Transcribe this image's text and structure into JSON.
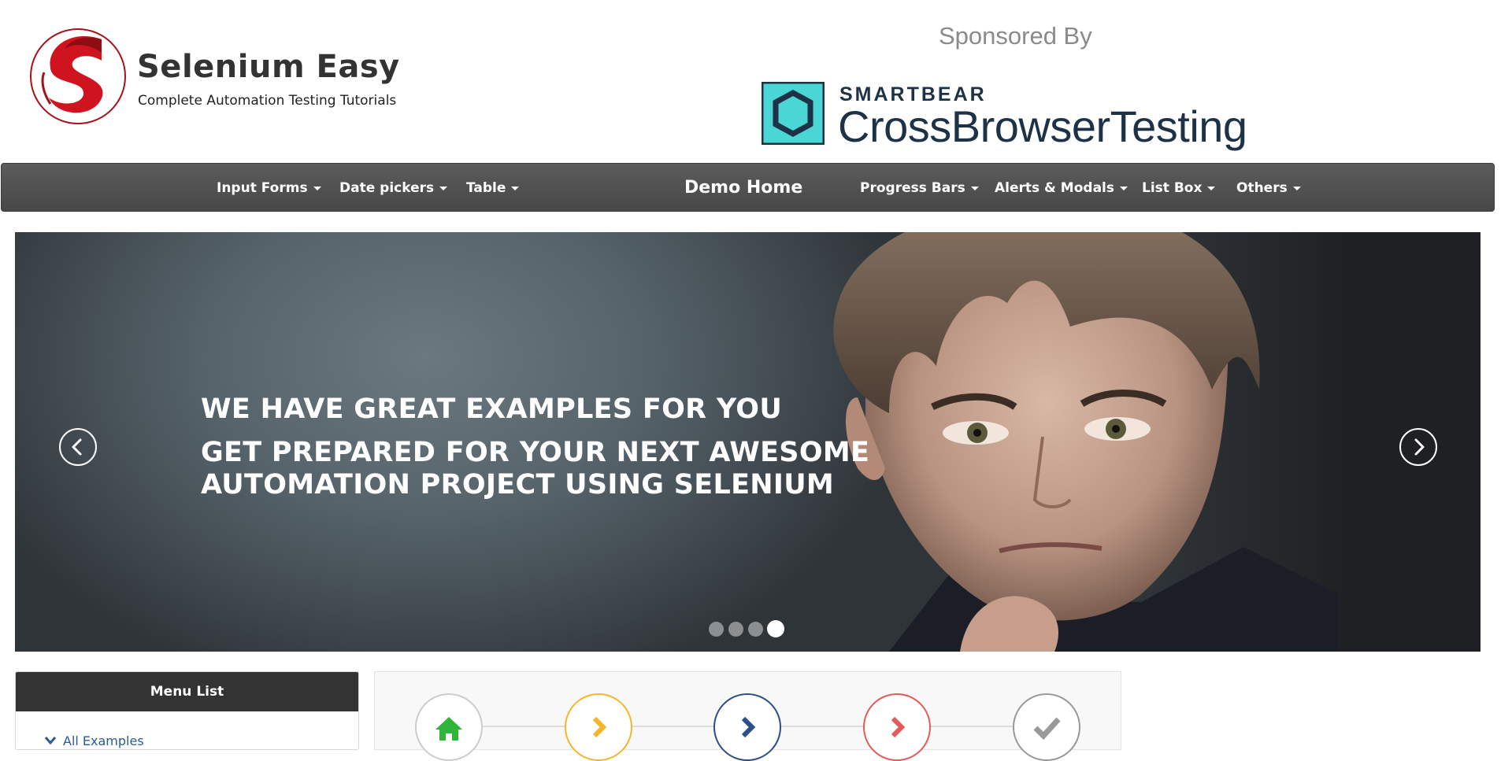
{
  "brand": {
    "title": "Selenium Easy",
    "tagline": "Complete Automation Testing Tutorials"
  },
  "sponsor": {
    "label": "Sponsored By",
    "brand": "SMARTBEAR",
    "product": "CrossBrowserTesting"
  },
  "nav": {
    "items_left": [
      "Input Forms",
      "Date pickers",
      "Table"
    ],
    "home": "Demo Home",
    "items_right": [
      "Progress Bars",
      "Alerts & Modals",
      "List Box",
      "Others"
    ]
  },
  "carousel": {
    "heading": "WE HAVE GREAT EXAMPLES FOR YOU",
    "subheading_line1": "GET PREPARED FOR YOUR NEXT AWESOME",
    "subheading_line2": "AUTOMATION PROJECT USING SELENIUM",
    "slide_count": 4,
    "active_slide": 4
  },
  "menu": {
    "header": "Menu List",
    "items": [
      "All Examples"
    ]
  },
  "steps": {
    "icons": [
      "home-icon",
      "chevron-right-icon",
      "chevron-right-icon",
      "chevron-right-icon",
      "check-icon"
    ],
    "colors": [
      "#2fb53a",
      "#f5b62b",
      "#2a4f8a",
      "#e25a5a",
      "#999999"
    ]
  },
  "colors": {
    "nav_bg": "#4f4f4f",
    "menu_header_bg": "#333333",
    "link": "#2a5c9a",
    "sponsor_teal": "#4bd6d6",
    "sponsor_navy": "#1d3246",
    "logo_red": "#c8141e"
  }
}
